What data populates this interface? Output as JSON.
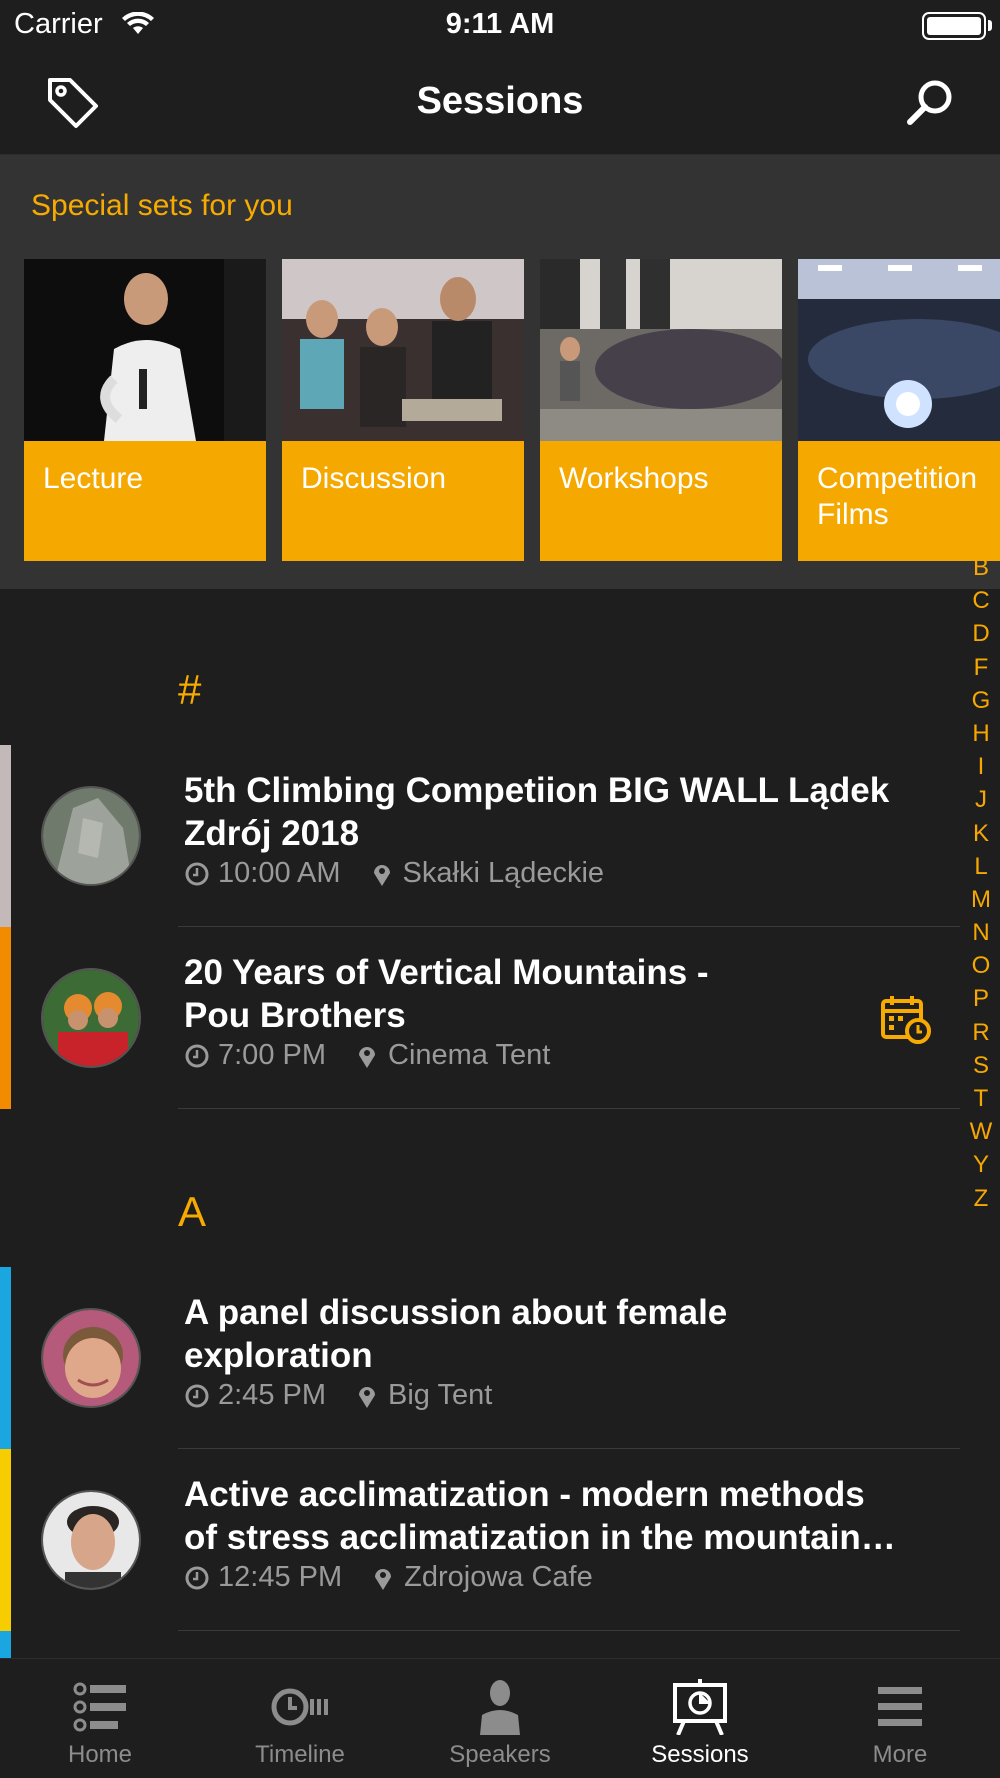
{
  "status_bar": {
    "carrier": "Carrier",
    "time": "9:11 AM"
  },
  "nav": {
    "title": "Sessions",
    "left_icon": "tag-icon",
    "right_icon": "search-icon"
  },
  "special_sets": {
    "title": "Special sets for you",
    "cards": [
      {
        "label": "Lecture",
        "label_line2": ""
      },
      {
        "label": "Discussion",
        "label_line2": ""
      },
      {
        "label": "Workshops",
        "label_line2": ""
      },
      {
        "label": "Competition",
        "label_line2": "Films"
      }
    ]
  },
  "index_letters": [
    "B",
    "C",
    "D",
    "F",
    "G",
    "H",
    "I",
    "J",
    "K",
    "L",
    "M",
    "N",
    "O",
    "P",
    "R",
    "S",
    "T",
    "W",
    "Y",
    "Z"
  ],
  "sections": [
    {
      "header": "#",
      "sessions": [
        {
          "title_line1": "5th Climbing Competiion BIG WALL Lądek",
          "title_line2": "Zdrój 2018",
          "time": "10:00 AM",
          "location": "Skałki Lądeckie",
          "accent": "#c4b9b9",
          "has_calendar": false
        },
        {
          "title_line1": "20 Years of Vertical Mountains -",
          "title_line2": "Pou Brothers",
          "time": "7:00 PM",
          "location": "Cinema Tent",
          "accent": "#f38b00",
          "has_calendar": true
        }
      ]
    },
    {
      "header": "A",
      "sessions": [
        {
          "title_line1": "A panel discussion about female",
          "title_line2": "exploration",
          "time": "2:45 PM",
          "location": "Big Tent",
          "accent": "#1aa6e0",
          "has_calendar": false
        },
        {
          "title_line1": "Active acclimatization - modern methods",
          "title_line2": "of stress acclimatization in the mountain…",
          "time": "12:45 PM",
          "location": "Zdrojowa Cafe",
          "accent": "#f7cc00",
          "has_calendar": false
        }
      ]
    }
  ],
  "colors": {
    "accent": "#f7ab00",
    "card": "#f5a800",
    "background": "#1e1e1e"
  },
  "tab_bar": {
    "tabs": [
      {
        "label": "Home",
        "icon": "list-icon"
      },
      {
        "label": "Timeline",
        "icon": "timeline-icon"
      },
      {
        "label": "Speakers",
        "icon": "person-icon"
      },
      {
        "label": "Sessions",
        "icon": "presentation-icon"
      },
      {
        "label": "More",
        "icon": "menu-icon"
      }
    ],
    "selected": "Sessions"
  }
}
